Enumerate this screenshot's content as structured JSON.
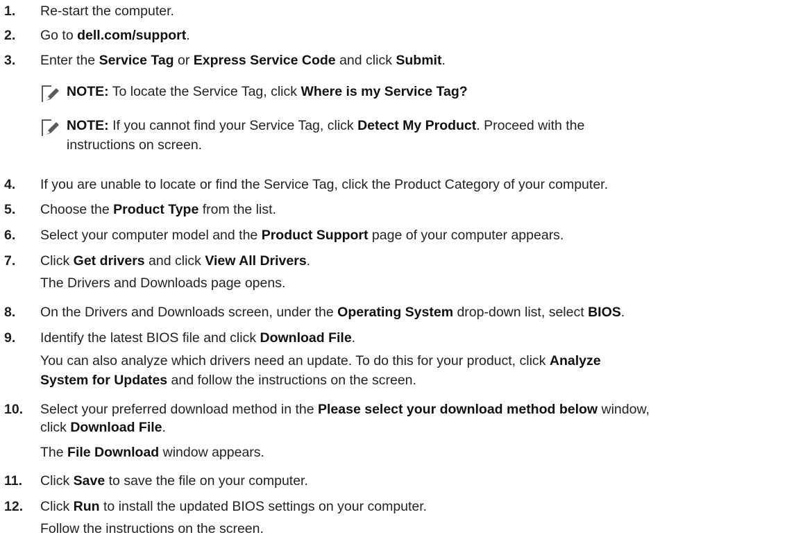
{
  "steps": [
    {
      "n": "1.",
      "segs": [
        {
          "t": "Re-start the computer.",
          "b": false
        }
      ]
    },
    {
      "n": "2.",
      "segs": [
        {
          "t": "Go to ",
          "b": false
        },
        {
          "t": "dell.com/support",
          "b": true
        },
        {
          "t": ".",
          "b": false
        }
      ]
    },
    {
      "n": "3.",
      "segs": [
        {
          "t": "Enter the ",
          "b": false
        },
        {
          "t": "Service Tag",
          "b": true
        },
        {
          "t": " or ",
          "b": false
        },
        {
          "t": "Express Service Code",
          "b": true
        },
        {
          "t": " and click ",
          "b": false
        },
        {
          "t": "Submit",
          "b": true
        },
        {
          "t": ".",
          "b": false
        }
      ]
    },
    {
      "n": "4.",
      "segs": [
        {
          "t": "If you are unable to locate or find the Service Tag, click the Product Category of your computer.",
          "b": false
        }
      ]
    },
    {
      "n": "5.",
      "segs": [
        {
          "t": "Choose the ",
          "b": false
        },
        {
          "t": "Product Type",
          "b": true
        },
        {
          "t": " from the list.",
          "b": false
        }
      ]
    },
    {
      "n": "6.",
      "segs": [
        {
          "t": "Select your computer model and the ",
          "b": false
        },
        {
          "t": "Product Support",
          "b": true
        },
        {
          "t": " page of your computer appears.",
          "b": false
        }
      ]
    },
    {
      "n": "7.",
      "segs": [
        {
          "t": "Click ",
          "b": false
        },
        {
          "t": "Get drivers",
          "b": true
        },
        {
          "t": " and click ",
          "b": false
        },
        {
          "t": "View All Drivers",
          "b": true
        },
        {
          "t": ".",
          "b": false
        }
      ]
    },
    {
      "n": "8.",
      "segs": [
        {
          "t": "On the Drivers and Downloads screen, under the ",
          "b": false
        },
        {
          "t": "Operating System",
          "b": true
        },
        {
          "t": " drop-down list, select ",
          "b": false
        },
        {
          "t": "BIOS",
          "b": true
        },
        {
          "t": ".",
          "b": false
        }
      ]
    },
    {
      "n": "9.",
      "segs": [
        {
          "t": "Identify the latest BIOS file and click ",
          "b": false
        },
        {
          "t": "Download File",
          "b": true
        },
        {
          "t": ".",
          "b": false
        }
      ]
    },
    {
      "n": "10.",
      "segs": [
        {
          "t": "Select your preferred download method in the ",
          "b": false
        },
        {
          "t": "Please select your download method below",
          "b": true
        },
        {
          "t": " window,",
          "b": false
        }
      ]
    },
    {
      "n": "11.",
      "segs": [
        {
          "t": "Click ",
          "b": false
        },
        {
          "t": "Save",
          "b": true
        },
        {
          "t": " to save the file on your computer.",
          "b": false
        }
      ]
    },
    {
      "n": "12.",
      "segs": [
        {
          "t": "Click ",
          "b": false
        },
        {
          "t": "Run",
          "b": true
        },
        {
          "t": " to install the updated BIOS settings on your computer.",
          "b": false
        }
      ]
    }
  ],
  "notes": [
    {
      "label": "NOTE:",
      "segs": [
        {
          "t": " To locate the Service Tag, click ",
          "b": false
        },
        {
          "t": "Where is my Service Tag?",
          "b": true
        }
      ]
    },
    {
      "label": "NOTE:",
      "segs": [
        {
          "t": " If you cannot find your Service Tag, click ",
          "b": false
        },
        {
          "t": "Detect My Product",
          "b": true
        },
        {
          "t": ". Proceed with the",
          "b": false
        }
      ],
      "cont": [
        {
          "t": "instructions on screen.",
          "b": false
        }
      ]
    }
  ],
  "continuations": [
    {
      "segs": [
        {
          "t": "The Drivers and Downloads page opens.",
          "b": false
        }
      ]
    },
    {
      "segs": [
        {
          "t": "You can also analyze which drivers need an update. To do this for your product, click ",
          "b": false
        },
        {
          "t": "Analyze",
          "b": true
        }
      ]
    },
    {
      "segs": [
        {
          "t": "System for Updates",
          "b": true
        },
        {
          "t": " and follow the instructions on the screen.",
          "b": false
        }
      ]
    },
    {
      "segs": [
        {
          "t": "click ",
          "b": false
        },
        {
          "t": "Download File",
          "b": true
        },
        {
          "t": ".",
          "b": false
        }
      ]
    },
    {
      "segs": [
        {
          "t": "The ",
          "b": false
        },
        {
          "t": "File Download",
          "b": true
        },
        {
          "t": " window appears.",
          "b": false
        }
      ]
    },
    {
      "segs": [
        {
          "t": "Follow the instructions on the screen.",
          "b": false
        }
      ]
    }
  ],
  "icons": {
    "note": "note-pencil-icon"
  }
}
